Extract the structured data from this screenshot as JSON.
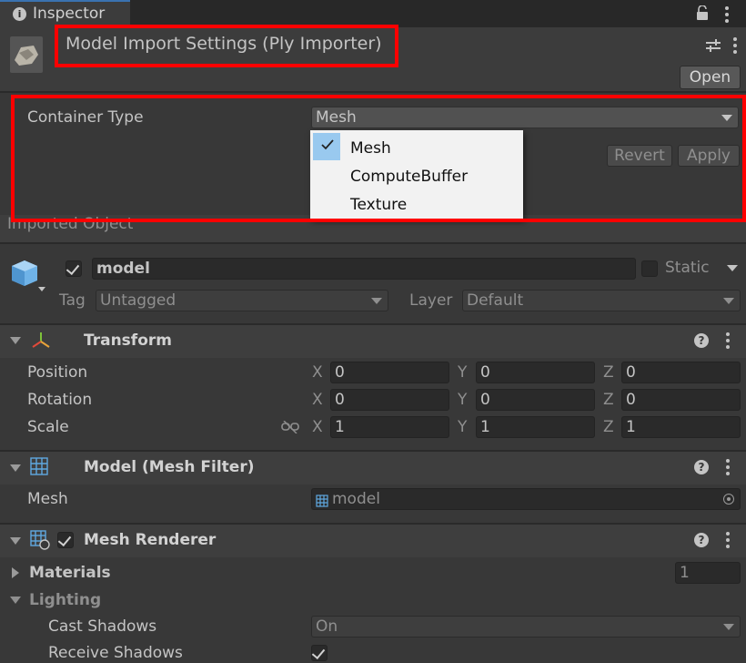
{
  "tab": {
    "title": "Inspector",
    "info_icon": "info-icon"
  },
  "header": {
    "title": "Model Import Settings (Ply Importer)",
    "open_button": "Open"
  },
  "importer": {
    "container_label": "Container Type",
    "container_value": "Mesh",
    "revert_button": "Revert",
    "apply_button": "Apply",
    "dropdown_options": [
      {
        "label": "Mesh",
        "selected": true
      },
      {
        "label": "ComputeBuffer",
        "selected": false
      },
      {
        "label": "Texture",
        "selected": false
      }
    ]
  },
  "imported_section": {
    "title": "Imported Object"
  },
  "object": {
    "name": "model",
    "static_label": "Static",
    "tag_label": "Tag",
    "tag_value": "Untagged",
    "layer_label": "Layer",
    "layer_value": "Default"
  },
  "transform": {
    "title": "Transform",
    "rows": [
      {
        "label": "Position",
        "x": "0",
        "y": "0",
        "z": "0"
      },
      {
        "label": "Rotation",
        "x": "0",
        "y": "0",
        "z": "0"
      },
      {
        "label": "Scale",
        "x": "1",
        "y": "1",
        "z": "1"
      }
    ],
    "axis_x": "X",
    "axis_y": "Y",
    "axis_z": "Z"
  },
  "mesh_filter": {
    "title": "Model (Mesh Filter)",
    "mesh_label": "Mesh",
    "mesh_value": "model"
  },
  "mesh_renderer": {
    "title": "Mesh Renderer",
    "materials_label": "Materials",
    "materials_count": "1",
    "lighting_label": "Lighting",
    "cast_shadows_label": "Cast Shadows",
    "cast_shadows_value": "On",
    "receive_shadows_label": "Receive Shadows"
  },
  "colors": {
    "highlight": "#ff0000",
    "panel_bg": "#383838",
    "selection": "#99c9ef"
  }
}
